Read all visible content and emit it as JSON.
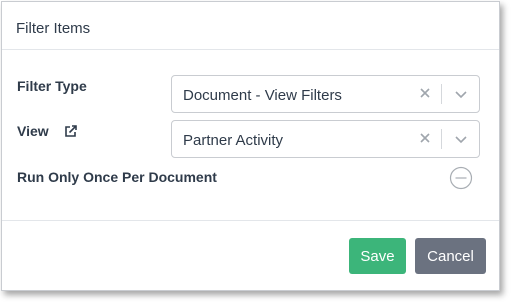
{
  "dialog": {
    "title": "Filter Items"
  },
  "form": {
    "filter_type": {
      "label": "Filter Type",
      "value": "Document - View Filters"
    },
    "view": {
      "label": "View",
      "value": "Partner Activity"
    },
    "run_once": {
      "label": "Run Only Once Per Document"
    }
  },
  "footer": {
    "save_label": "Save",
    "cancel_label": "Cancel"
  },
  "colors": {
    "save": "#3cb57a",
    "cancel": "#6b7280",
    "text": "#2f3b4a"
  }
}
